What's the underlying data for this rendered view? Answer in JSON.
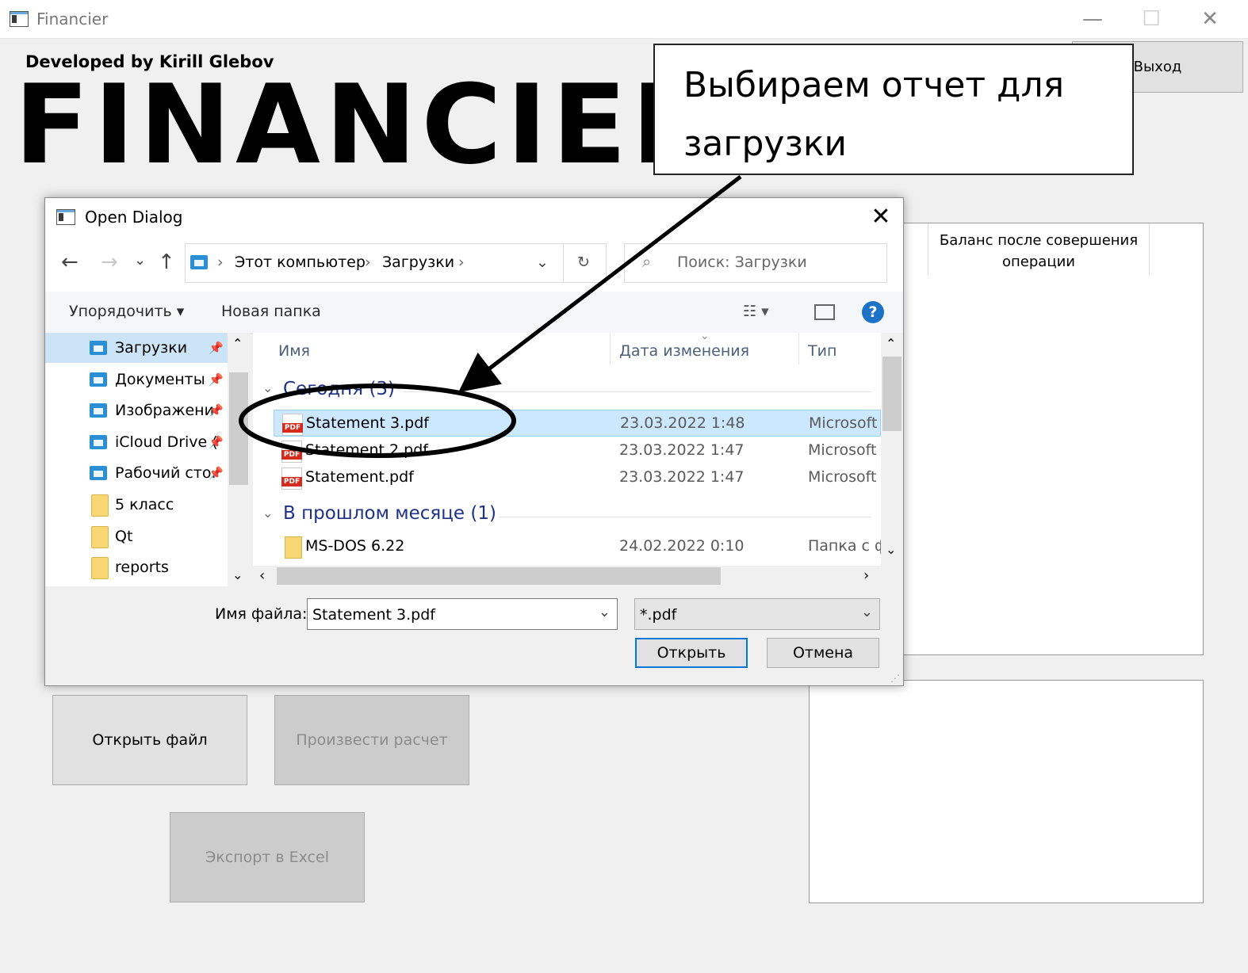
{
  "app": {
    "title": "Financier",
    "minimize": "—",
    "maximize": "☐",
    "close": "✕",
    "developed_by": "Developed by Kirill Glebov",
    "logo": "FINANCIER",
    "exit_label": "Выход",
    "balance_header": "Баланс после совершения операции",
    "open_file_label": "Открыть файл",
    "calc_label": "Произвести расчет",
    "export_label": "Экспорт в Excel"
  },
  "annotation": {
    "text": "Выбираем отчет  для загрузки"
  },
  "dialog": {
    "title": "Open Dialog",
    "close": "✕",
    "nav": {
      "back": "←",
      "forward": "→",
      "recent": "⌄",
      "up": "↑",
      "refresh": "↻",
      "addr_dropdown": "⌄"
    },
    "breadcrumbs": [
      "Этот компьютер",
      "Загрузки"
    ],
    "search_placeholder": "Поиск: Загрузки",
    "toolbar": {
      "organize": "Упорядочить ▾",
      "new_folder": "Новая папка",
      "help": "?"
    },
    "sidebar": [
      {
        "label": "Загрузки",
        "icon": "downloads-folder-icon",
        "pinned": true,
        "selected": true
      },
      {
        "label": "Документы",
        "icon": "documents-folder-icon",
        "pinned": true
      },
      {
        "label": "Изображени",
        "icon": "pictures-folder-icon",
        "pinned": true
      },
      {
        "label": "iCloud Drive (",
        "icon": "icloud-folder-icon",
        "pinned": true
      },
      {
        "label": "Рабочий сто.",
        "icon": "desktop-folder-icon",
        "pinned": true
      },
      {
        "label": "5 класс",
        "icon": "folder-icon"
      },
      {
        "label": "Qt",
        "icon": "folder-icon"
      },
      {
        "label": "reports",
        "icon": "folder-icon"
      }
    ],
    "columns": {
      "name": "Имя",
      "date": "Дата изменения",
      "type": "Тип"
    },
    "groups": [
      {
        "label": "Сегодня (3)",
        "files": [
          {
            "name": "Statement 3.pdf",
            "date": "23.03.2022 1:48",
            "type": "Microsoft Edge PDF",
            "selected": true
          },
          {
            "name": "Statement 2.pdf",
            "date": "23.03.2022 1:47",
            "type": "Microsoft Edge PDF"
          },
          {
            "name": "Statement.pdf",
            "date": "23.03.2022 1:47",
            "type": "Microsoft Edge PDF"
          }
        ]
      },
      {
        "label": "В прошлом месяце (1)",
        "files": [
          {
            "name": "MS-DOS 6.22",
            "date": "24.02.2022 0:10",
            "type": "Папка с файлами"
          }
        ]
      }
    ],
    "filename_label": "Имя файла:",
    "filename_value": "Statement 3.pdf",
    "filter_value": "*.pdf",
    "open_label": "Открыть",
    "cancel_label": "Отмена"
  },
  "colors": {
    "selection": "#cce8ff",
    "accent": "#0078d7",
    "group_header": "#1e3287"
  }
}
